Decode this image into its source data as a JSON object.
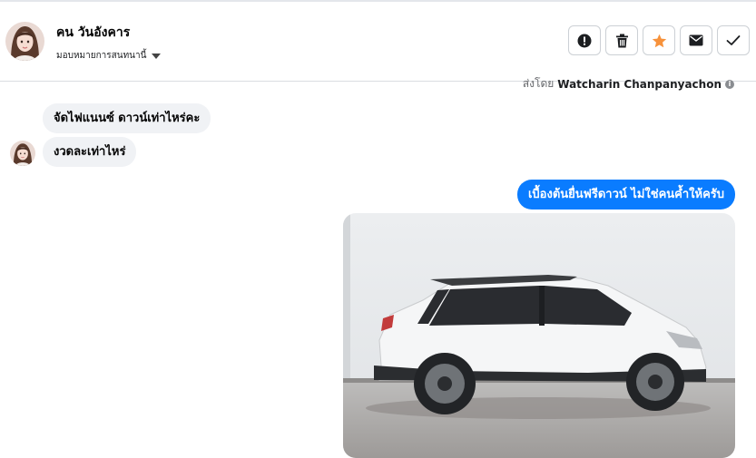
{
  "header": {
    "contact_name": "คน วันอังคาร",
    "assign_label": "มอบหมายการสนทนานี้",
    "actions": [
      {
        "name": "spam-button",
        "icon": "alert-circle-icon"
      },
      {
        "name": "delete-button",
        "icon": "trash-icon"
      },
      {
        "name": "star-button",
        "icon": "star-icon"
      },
      {
        "name": "mark-unread-button",
        "icon": "envelope-icon"
      },
      {
        "name": "mark-done-button",
        "icon": "check-icon"
      }
    ],
    "star_color": "#f7923b"
  },
  "conversation": {
    "sent_by_prefix": "ส่งโดย",
    "sent_by_name": "Watcharin Chanpanyachon",
    "messages": [
      {
        "direction": "incoming",
        "text": "จัดไฟแนนซ์ ดาวน์เท่าไหร่คะ"
      },
      {
        "direction": "incoming",
        "text": "งวดละเท่าไหร่"
      },
      {
        "direction": "outgoing",
        "text": "เบื้องต้นยื่นฟรีดาวน์ ไม่ใช่คนค้ำให้ครับ"
      }
    ],
    "outgoing_color": "#0a7cff"
  }
}
